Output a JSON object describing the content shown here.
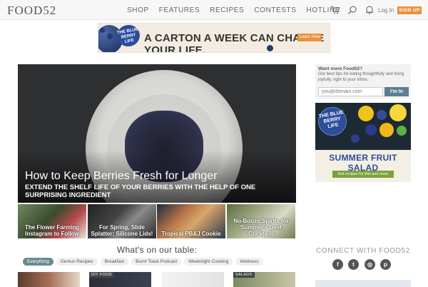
{
  "header": {
    "logo": "FOOD52",
    "nav": [
      "SHOP",
      "FEATURES",
      "RECIPES",
      "CONTESTS",
      "HOTLINE"
    ],
    "login": "Log In",
    "signup": "SIGN UP",
    "icons": [
      "cart-icon",
      "search-icon",
      "bell-icon"
    ]
  },
  "top_ad": {
    "badge": "THE BLUE BERRY LIFE",
    "tagline": "A CARTON A WEEK CAN CHANGE YOUR LIFE.",
    "button": "Learn How"
  },
  "hero": {
    "title": "How to Keep Berries Fresh for Longer",
    "subtitle": "EXTEND THE SHELF LIFE OF YOUR BERRIES WITH THE HELP OF ONE SURPRISING INGREDIENT"
  },
  "thumbnails": [
    {
      "caption": "The Flower Farming Instagram to Follow"
    },
    {
      "caption": "For Spring, Slide Splatter: Silicone Lids!"
    },
    {
      "caption": "Tropical PB&J Cookie"
    },
    {
      "caption": "No-Booze Spirits for Summer's Best Cocktails"
    }
  ],
  "table": {
    "title": "What's on our table:",
    "filters": [
      "Everything",
      "Genius Recipes",
      "Breakfast",
      "Burnt Toast Podcast",
      "Weeknight Cooking",
      "Wellness"
    ],
    "active_filter": "Everything"
  },
  "cards": [
    {
      "tag": ""
    },
    {
      "tag": "DIY FOOD"
    },
    {
      "tag": ""
    },
    {
      "tag": "SALADS"
    }
  ],
  "newsletter": {
    "heading": "Want more Food52?",
    "description": "Our best tips for eating thoughtfully and living joyfully, right to your inbox.",
    "placeholder": "you@domain.com",
    "button": "I'm In"
  },
  "side_ad": {
    "badge": "THE BLUE BERRY LIFE",
    "headline": "SUMMER FRUIT SALAD",
    "button": "Get recipes for this and more"
  },
  "connect": {
    "title": "CONNECT WITH FOOD52",
    "networks": [
      "facebook-icon",
      "twitter-icon",
      "instagram-icon",
      "pinterest-icon"
    ]
  },
  "colors": {
    "signup_orange": "#e8923f",
    "filter_active": "#6a8a8e",
    "newsletter_button": "#5a7f94",
    "ad_blue": "#2b4d9a",
    "ad_green": "#7aa23c"
  }
}
